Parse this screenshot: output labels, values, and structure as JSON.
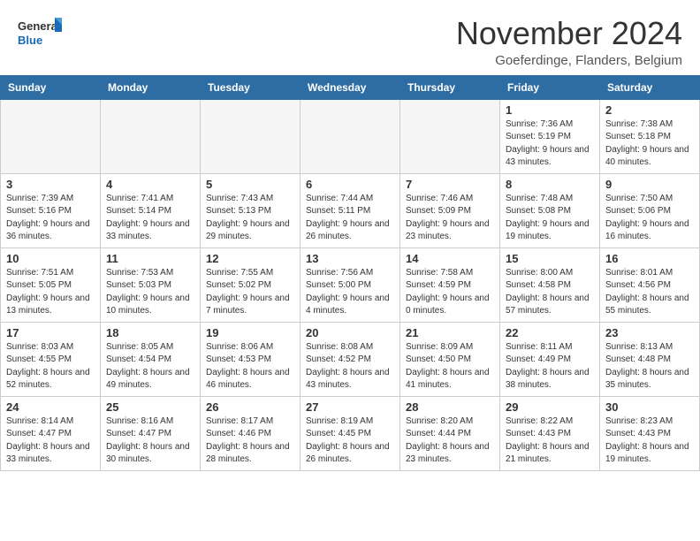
{
  "logo": {
    "line1": "General",
    "line2": "Blue"
  },
  "title": "November 2024",
  "location": "Goeferdinge, Flanders, Belgium",
  "weekdays": [
    "Sunday",
    "Monday",
    "Tuesday",
    "Wednesday",
    "Thursday",
    "Friday",
    "Saturday"
  ],
  "weeks": [
    [
      {
        "day": "",
        "info": ""
      },
      {
        "day": "",
        "info": ""
      },
      {
        "day": "",
        "info": ""
      },
      {
        "day": "",
        "info": ""
      },
      {
        "day": "",
        "info": ""
      },
      {
        "day": "1",
        "info": "Sunrise: 7:36 AM\nSunset: 5:19 PM\nDaylight: 9 hours and 43 minutes."
      },
      {
        "day": "2",
        "info": "Sunrise: 7:38 AM\nSunset: 5:18 PM\nDaylight: 9 hours and 40 minutes."
      }
    ],
    [
      {
        "day": "3",
        "info": "Sunrise: 7:39 AM\nSunset: 5:16 PM\nDaylight: 9 hours and 36 minutes."
      },
      {
        "day": "4",
        "info": "Sunrise: 7:41 AM\nSunset: 5:14 PM\nDaylight: 9 hours and 33 minutes."
      },
      {
        "day": "5",
        "info": "Sunrise: 7:43 AM\nSunset: 5:13 PM\nDaylight: 9 hours and 29 minutes."
      },
      {
        "day": "6",
        "info": "Sunrise: 7:44 AM\nSunset: 5:11 PM\nDaylight: 9 hours and 26 minutes."
      },
      {
        "day": "7",
        "info": "Sunrise: 7:46 AM\nSunset: 5:09 PM\nDaylight: 9 hours and 23 minutes."
      },
      {
        "day": "8",
        "info": "Sunrise: 7:48 AM\nSunset: 5:08 PM\nDaylight: 9 hours and 19 minutes."
      },
      {
        "day": "9",
        "info": "Sunrise: 7:50 AM\nSunset: 5:06 PM\nDaylight: 9 hours and 16 minutes."
      }
    ],
    [
      {
        "day": "10",
        "info": "Sunrise: 7:51 AM\nSunset: 5:05 PM\nDaylight: 9 hours and 13 minutes."
      },
      {
        "day": "11",
        "info": "Sunrise: 7:53 AM\nSunset: 5:03 PM\nDaylight: 9 hours and 10 minutes."
      },
      {
        "day": "12",
        "info": "Sunrise: 7:55 AM\nSunset: 5:02 PM\nDaylight: 9 hours and 7 minutes."
      },
      {
        "day": "13",
        "info": "Sunrise: 7:56 AM\nSunset: 5:00 PM\nDaylight: 9 hours and 4 minutes."
      },
      {
        "day": "14",
        "info": "Sunrise: 7:58 AM\nSunset: 4:59 PM\nDaylight: 9 hours and 0 minutes."
      },
      {
        "day": "15",
        "info": "Sunrise: 8:00 AM\nSunset: 4:58 PM\nDaylight: 8 hours and 57 minutes."
      },
      {
        "day": "16",
        "info": "Sunrise: 8:01 AM\nSunset: 4:56 PM\nDaylight: 8 hours and 55 minutes."
      }
    ],
    [
      {
        "day": "17",
        "info": "Sunrise: 8:03 AM\nSunset: 4:55 PM\nDaylight: 8 hours and 52 minutes."
      },
      {
        "day": "18",
        "info": "Sunrise: 8:05 AM\nSunset: 4:54 PM\nDaylight: 8 hours and 49 minutes."
      },
      {
        "day": "19",
        "info": "Sunrise: 8:06 AM\nSunset: 4:53 PM\nDaylight: 8 hours and 46 minutes."
      },
      {
        "day": "20",
        "info": "Sunrise: 8:08 AM\nSunset: 4:52 PM\nDaylight: 8 hours and 43 minutes."
      },
      {
        "day": "21",
        "info": "Sunrise: 8:09 AM\nSunset: 4:50 PM\nDaylight: 8 hours and 41 minutes."
      },
      {
        "day": "22",
        "info": "Sunrise: 8:11 AM\nSunset: 4:49 PM\nDaylight: 8 hours and 38 minutes."
      },
      {
        "day": "23",
        "info": "Sunrise: 8:13 AM\nSunset: 4:48 PM\nDaylight: 8 hours and 35 minutes."
      }
    ],
    [
      {
        "day": "24",
        "info": "Sunrise: 8:14 AM\nSunset: 4:47 PM\nDaylight: 8 hours and 33 minutes."
      },
      {
        "day": "25",
        "info": "Sunrise: 8:16 AM\nSunset: 4:47 PM\nDaylight: 8 hours and 30 minutes."
      },
      {
        "day": "26",
        "info": "Sunrise: 8:17 AM\nSunset: 4:46 PM\nDaylight: 8 hours and 28 minutes."
      },
      {
        "day": "27",
        "info": "Sunrise: 8:19 AM\nSunset: 4:45 PM\nDaylight: 8 hours and 26 minutes."
      },
      {
        "day": "28",
        "info": "Sunrise: 8:20 AM\nSunset: 4:44 PM\nDaylight: 8 hours and 23 minutes."
      },
      {
        "day": "29",
        "info": "Sunrise: 8:22 AM\nSunset: 4:43 PM\nDaylight: 8 hours and 21 minutes."
      },
      {
        "day": "30",
        "info": "Sunrise: 8:23 AM\nSunset: 4:43 PM\nDaylight: 8 hours and 19 minutes."
      }
    ]
  ]
}
